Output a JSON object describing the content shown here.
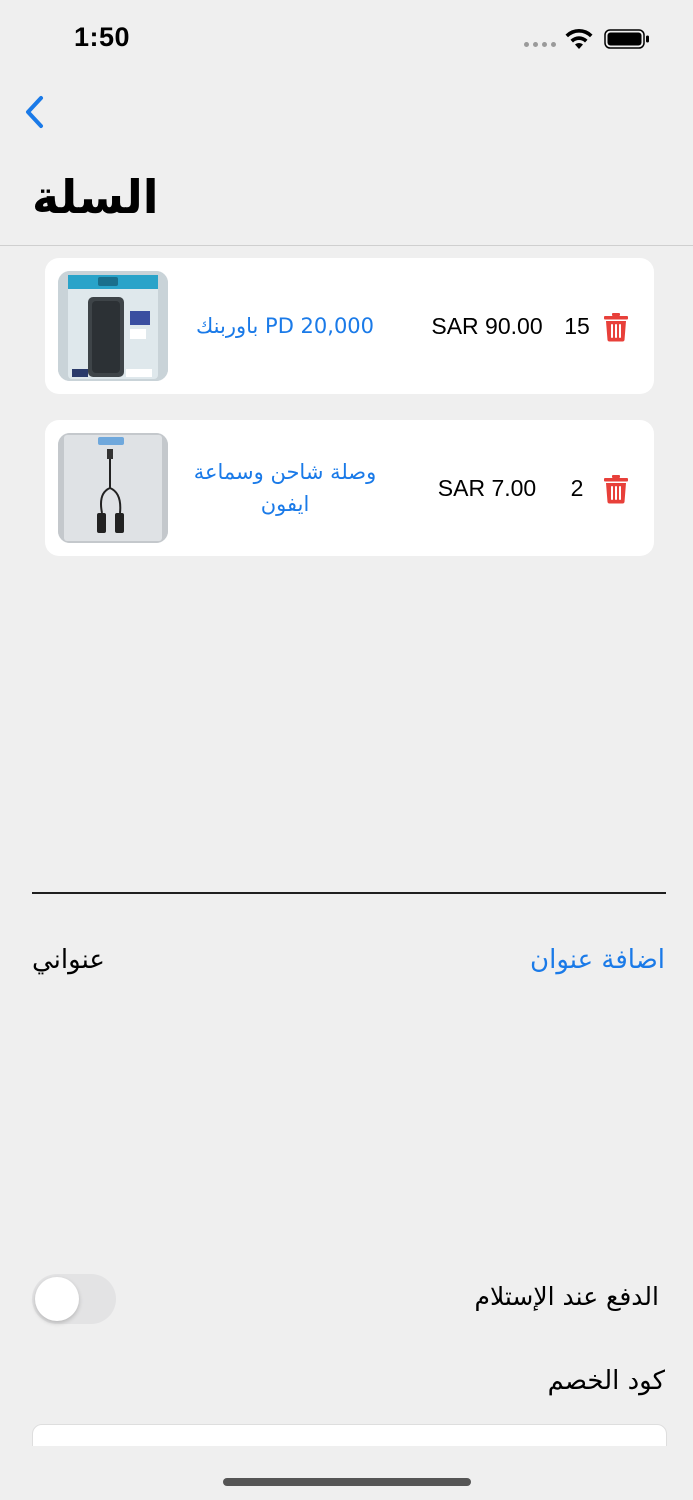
{
  "status_bar": {
    "time": "1:50"
  },
  "header": {
    "title": "السلة"
  },
  "cart": {
    "items": [
      {
        "name": "باوربنك PD 20,000",
        "price": "SAR 90.00",
        "quantity": "15"
      },
      {
        "name": "وصلة شاحن وسماعة ايفون",
        "price": "SAR 7.00",
        "quantity": "2"
      }
    ]
  },
  "address": {
    "label": "عنواني",
    "add_label": "اضافة عنوان"
  },
  "payment": {
    "cod_label": "الدفع عند الإستلام",
    "cod_enabled": false
  },
  "discount": {
    "label": "كود الخصم",
    "value": ""
  },
  "colors": {
    "accent": "#1a7ae8",
    "delete": "#e8403a",
    "background": "#efefef"
  }
}
